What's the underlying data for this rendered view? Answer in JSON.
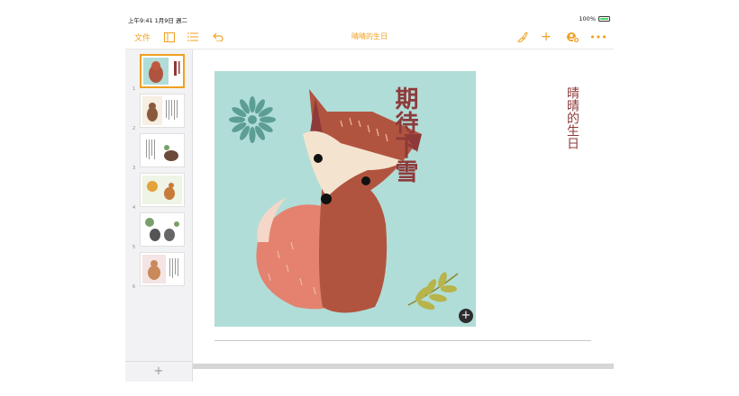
{
  "status": {
    "time": "上午9:41  1月9日 週二",
    "battery": "100%"
  },
  "toolbar": {
    "documents_label": "文件",
    "title": "晴晴的生日"
  },
  "sidebar": {
    "slides": [
      "1",
      "2",
      "3",
      "4",
      "5",
      "6"
    ]
  },
  "slide": {
    "headline": "期待下雪",
    "subhead": "晴晴的生日"
  },
  "add_slide_label": "+",
  "add_media_label": "+",
  "colors": {
    "accent": "#f0a020",
    "title_text": "#8e3a3a",
    "image_bg": "#b1ddd8"
  }
}
